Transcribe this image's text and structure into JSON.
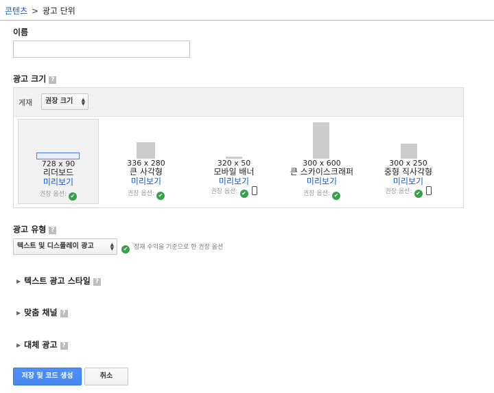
{
  "breadcrumb": {
    "link": "콘텐츠",
    "separator": ">",
    "current": "광고 단위"
  },
  "name_field": {
    "label": "이름",
    "value": "",
    "placeholder": ""
  },
  "ad_size": {
    "label": "광고 크기",
    "help_icon": "help-icon",
    "filter_label": "게재",
    "filter_value": "권장 크기",
    "options": [
      {
        "dimensions": "728 x 90",
        "name": "리더보드",
        "preview": "미리보기",
        "recommended": "권장 옵션:",
        "mobile": false,
        "selected": true
      },
      {
        "dimensions": "336 x 280",
        "name": "큰 사각형",
        "preview": "미리보기",
        "recommended": "권장 옵션:",
        "mobile": false,
        "selected": false
      },
      {
        "dimensions": "320 x 50",
        "name": "모바일 배너",
        "preview": "미리보기",
        "recommended": "권장 옵션:",
        "mobile": true,
        "selected": false
      },
      {
        "dimensions": "300 x 600",
        "name": "큰 스카이스크래퍼",
        "preview": "미리보기",
        "recommended": "권장 옵션:",
        "mobile": false,
        "selected": false
      },
      {
        "dimensions": "300 x 250",
        "name": "중형 직사각형",
        "preview": "미리보기",
        "recommended": "권장 옵션:",
        "mobile": true,
        "selected": false
      }
    ]
  },
  "ad_type": {
    "label": "광고 유형",
    "value": "텍스트 및 디스플레이 광고",
    "note": "잠재 수익을 기준으로 한 권장 옵션"
  },
  "sections": [
    {
      "label": "텍스트 광고 스타일"
    },
    {
      "label": "맞춤 채널"
    },
    {
      "label": "대체 광고"
    }
  ],
  "actions": {
    "save": "저장 및 코드 생성",
    "cancel": "취소"
  },
  "colors": {
    "link": "#1155cc",
    "primary": "#4d90fe",
    "check": "#37a04a"
  }
}
